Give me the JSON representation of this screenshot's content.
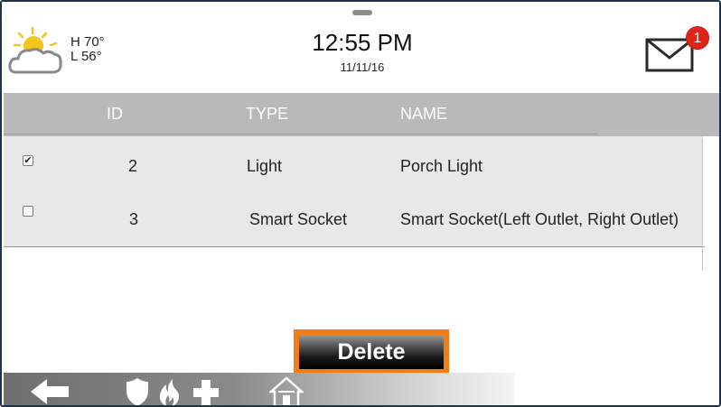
{
  "weather": {
    "high": "H 70°",
    "low": "L 56°",
    "icon": "partly-cloudy-icon"
  },
  "clock": {
    "time": "12:55 PM",
    "date": "11/11/16"
  },
  "notifications": {
    "count": "1",
    "icon": "mail-icon"
  },
  "table": {
    "headers": {
      "id": "ID",
      "type": "TYPE",
      "name": "NAME"
    },
    "rows": [
      {
        "checked": true,
        "id": "2",
        "type": "Light",
        "name": "Porch Light"
      },
      {
        "checked": false,
        "id": "3",
        "type": "Smart Socket",
        "name": "Smart Socket(Left Outlet, Right Outlet)"
      }
    ]
  },
  "actions": {
    "delete_label": "Delete"
  },
  "nav": {
    "icons": [
      "back-arrow-icon",
      "shield-icon",
      "fire-icon",
      "medical-cross-icon",
      "home-icon"
    ]
  },
  "colors": {
    "accent": "#f07d16",
    "badge": "#e0231b",
    "header_bg": "#b9b9b9",
    "row_bg": "#e8e8e8",
    "border": "#1e3350"
  }
}
